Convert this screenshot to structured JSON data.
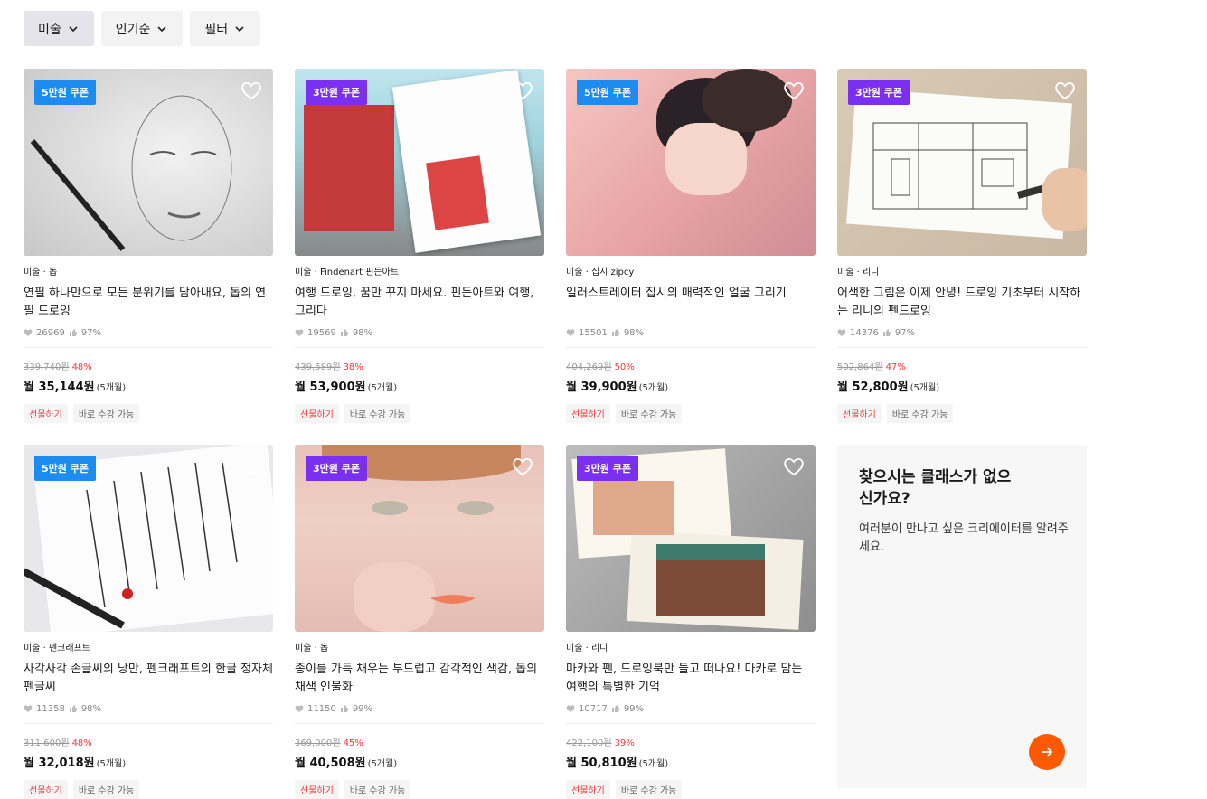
{
  "filters": [
    {
      "label": "미술",
      "active": true
    },
    {
      "label": "인기순",
      "active": false
    },
    {
      "label": "필터",
      "active": false
    }
  ],
  "cards": [
    {
      "coupon": "5만원 쿠폰",
      "coupon_color": "blue",
      "category": "미술",
      "creator": "돕",
      "title": "연필 하나만으로 모든 분위기를 담아내요, 돕의 연필 드로잉",
      "likes": "26969",
      "rating": "97%",
      "original": "339,740원",
      "discount": "48%",
      "price": "월 35,144원",
      "months": "(5개월)",
      "gift": "선물하기",
      "now": "바로 수강 가능",
      "thumb": "pencil-portrait"
    },
    {
      "coupon": "3만원 쿠폰",
      "coupon_color": "purple",
      "category": "미술",
      "creator": "Findenart 핀든아트",
      "title": "여행 드로잉, 꿈만 꾸지 마세요. 핀든아트와 여행, 그리다",
      "likes": "19569",
      "rating": "98%",
      "original": "439,589원",
      "discount": "38%",
      "price": "월 53,900원",
      "months": "(5개월)",
      "gift": "선물하기",
      "now": "바로 수강 가능",
      "thumb": "travel-drawing"
    },
    {
      "coupon": "5만원 쿠폰",
      "coupon_color": "blue",
      "category": "미술",
      "creator": "집시 zipcy",
      "title": "일러스트레이터 집시의 매력적인 얼굴 그리기",
      "likes": "15501",
      "rating": "98%",
      "original": "404,269원",
      "discount": "50%",
      "price": "월 39,900원",
      "months": "(5개월)",
      "gift": "선물하기",
      "now": "바로 수강 가능",
      "thumb": "illustration-couple"
    },
    {
      "coupon": "3만원 쿠폰",
      "coupon_color": "purple",
      "category": "미술",
      "creator": "리니",
      "title": "어색한 그림은 이제 안녕! 드로잉 기초부터 시작하는 리니의 펜드로잉",
      "likes": "14376",
      "rating": "97%",
      "original": "502,864원",
      "discount": "47%",
      "price": "월 52,800원",
      "months": "(5개월)",
      "gift": "선물하기",
      "now": "바로 수강 가능",
      "thumb": "pen-drawing"
    },
    {
      "coupon": "5만원 쿠폰",
      "coupon_color": "blue",
      "category": "미술",
      "creator": "펜크래프트",
      "title": "사각사각 손글씨의 낭만, 펜크래프트의 한글 정자체 펜글씨",
      "likes": "11358",
      "rating": "98%",
      "original": "311,600원",
      "discount": "48%",
      "price": "월 32,018원",
      "months": "(5개월)",
      "gift": "선물하기",
      "now": "바로 수강 가능",
      "thumb": "calligraphy"
    },
    {
      "coupon": "3만원 쿠폰",
      "coupon_color": "purple",
      "category": "미술",
      "creator": "돕",
      "title": "종이를 가득 채우는 부드럽고 감각적인 색감, 돕의 채색 인물화",
      "likes": "11150",
      "rating": "99%",
      "original": "369,000원",
      "discount": "45%",
      "price": "월 40,508원",
      "months": "(5개월)",
      "gift": "선물하기",
      "now": "바로 수강 가능",
      "thumb": "color-portrait"
    },
    {
      "coupon": "3만원 쿠폰",
      "coupon_color": "purple",
      "category": "미술",
      "creator": "리니",
      "title": "마카와 펜, 드로잉북만 들고 떠나요! 마카로 담는 여행의 특별한 기억",
      "likes": "10717",
      "rating": "99%",
      "original": "422,100원",
      "discount": "39%",
      "price": "월 50,810원",
      "months": "(5개월)",
      "gift": "선물하기",
      "now": "바로 수강 가능",
      "thumb": "marker-drawing"
    }
  ],
  "request": {
    "title": "찾으시는 클래스가 없으신가요?",
    "desc": "여러분이 만나고 싶은 크리에이터를 알려주세요."
  },
  "colors": {
    "accent": "#ff5a00",
    "coupon_blue": "#1d8cf0",
    "coupon_purple": "#7b2ff0",
    "discount": "#f03a3a"
  }
}
